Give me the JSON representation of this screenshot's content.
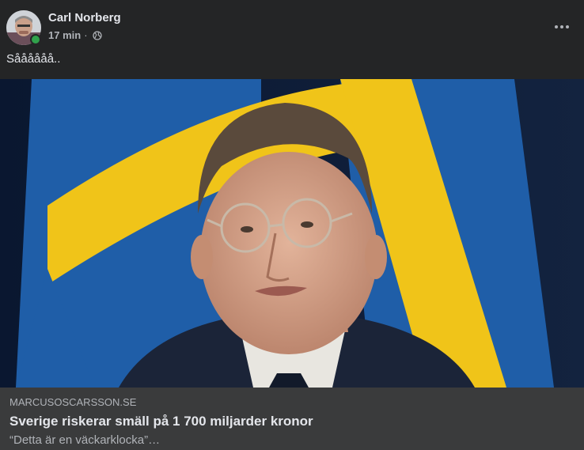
{
  "post": {
    "author_name": "Carl Norberg",
    "timestamp": "17 min",
    "separator": "·",
    "privacy_icon": "globe-icon",
    "more_icon": "more-horizontal-icon",
    "text": "Såååååå..",
    "online_status_color": "#31a24c"
  },
  "link_preview": {
    "domain": "MARCUSOSCARSSON.SE",
    "title": "Sverige riskerar smäll på 1 700 miljarder kronor",
    "description": "“Detta är en väckarklocka”…"
  },
  "colors": {
    "background": "#242526",
    "preview_background": "#3a3b3c",
    "primary_text": "#e4e6eb",
    "secondary_text": "#b0b3b8"
  }
}
